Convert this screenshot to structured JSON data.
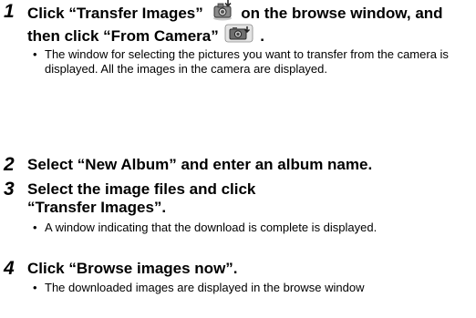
{
  "steps": [
    {
      "number": "1",
      "heading_part1": "Click “Transfer Images”",
      "heading_part2": "on the browse window, and then click “From Camera”",
      "heading_end": ".",
      "icons": [
        "transfer-images-icon",
        "from-camera-icon"
      ],
      "bullet": "The window for selecting the pictures you want to transfer from the camera is displayed. All the images in the camera are displayed."
    },
    {
      "number": "2",
      "heading": "Select “New Album” and enter an album name."
    },
    {
      "number": "3",
      "heading": "Select the image files and click “Transfer Images”.",
      "bullet": "A window indicating that the download is complete is displayed."
    },
    {
      "number": "4",
      "heading": "Click “Browse images now”.",
      "bullet": "The downloaded images are displayed in the browse window"
    }
  ],
  "bullet_char": "•"
}
